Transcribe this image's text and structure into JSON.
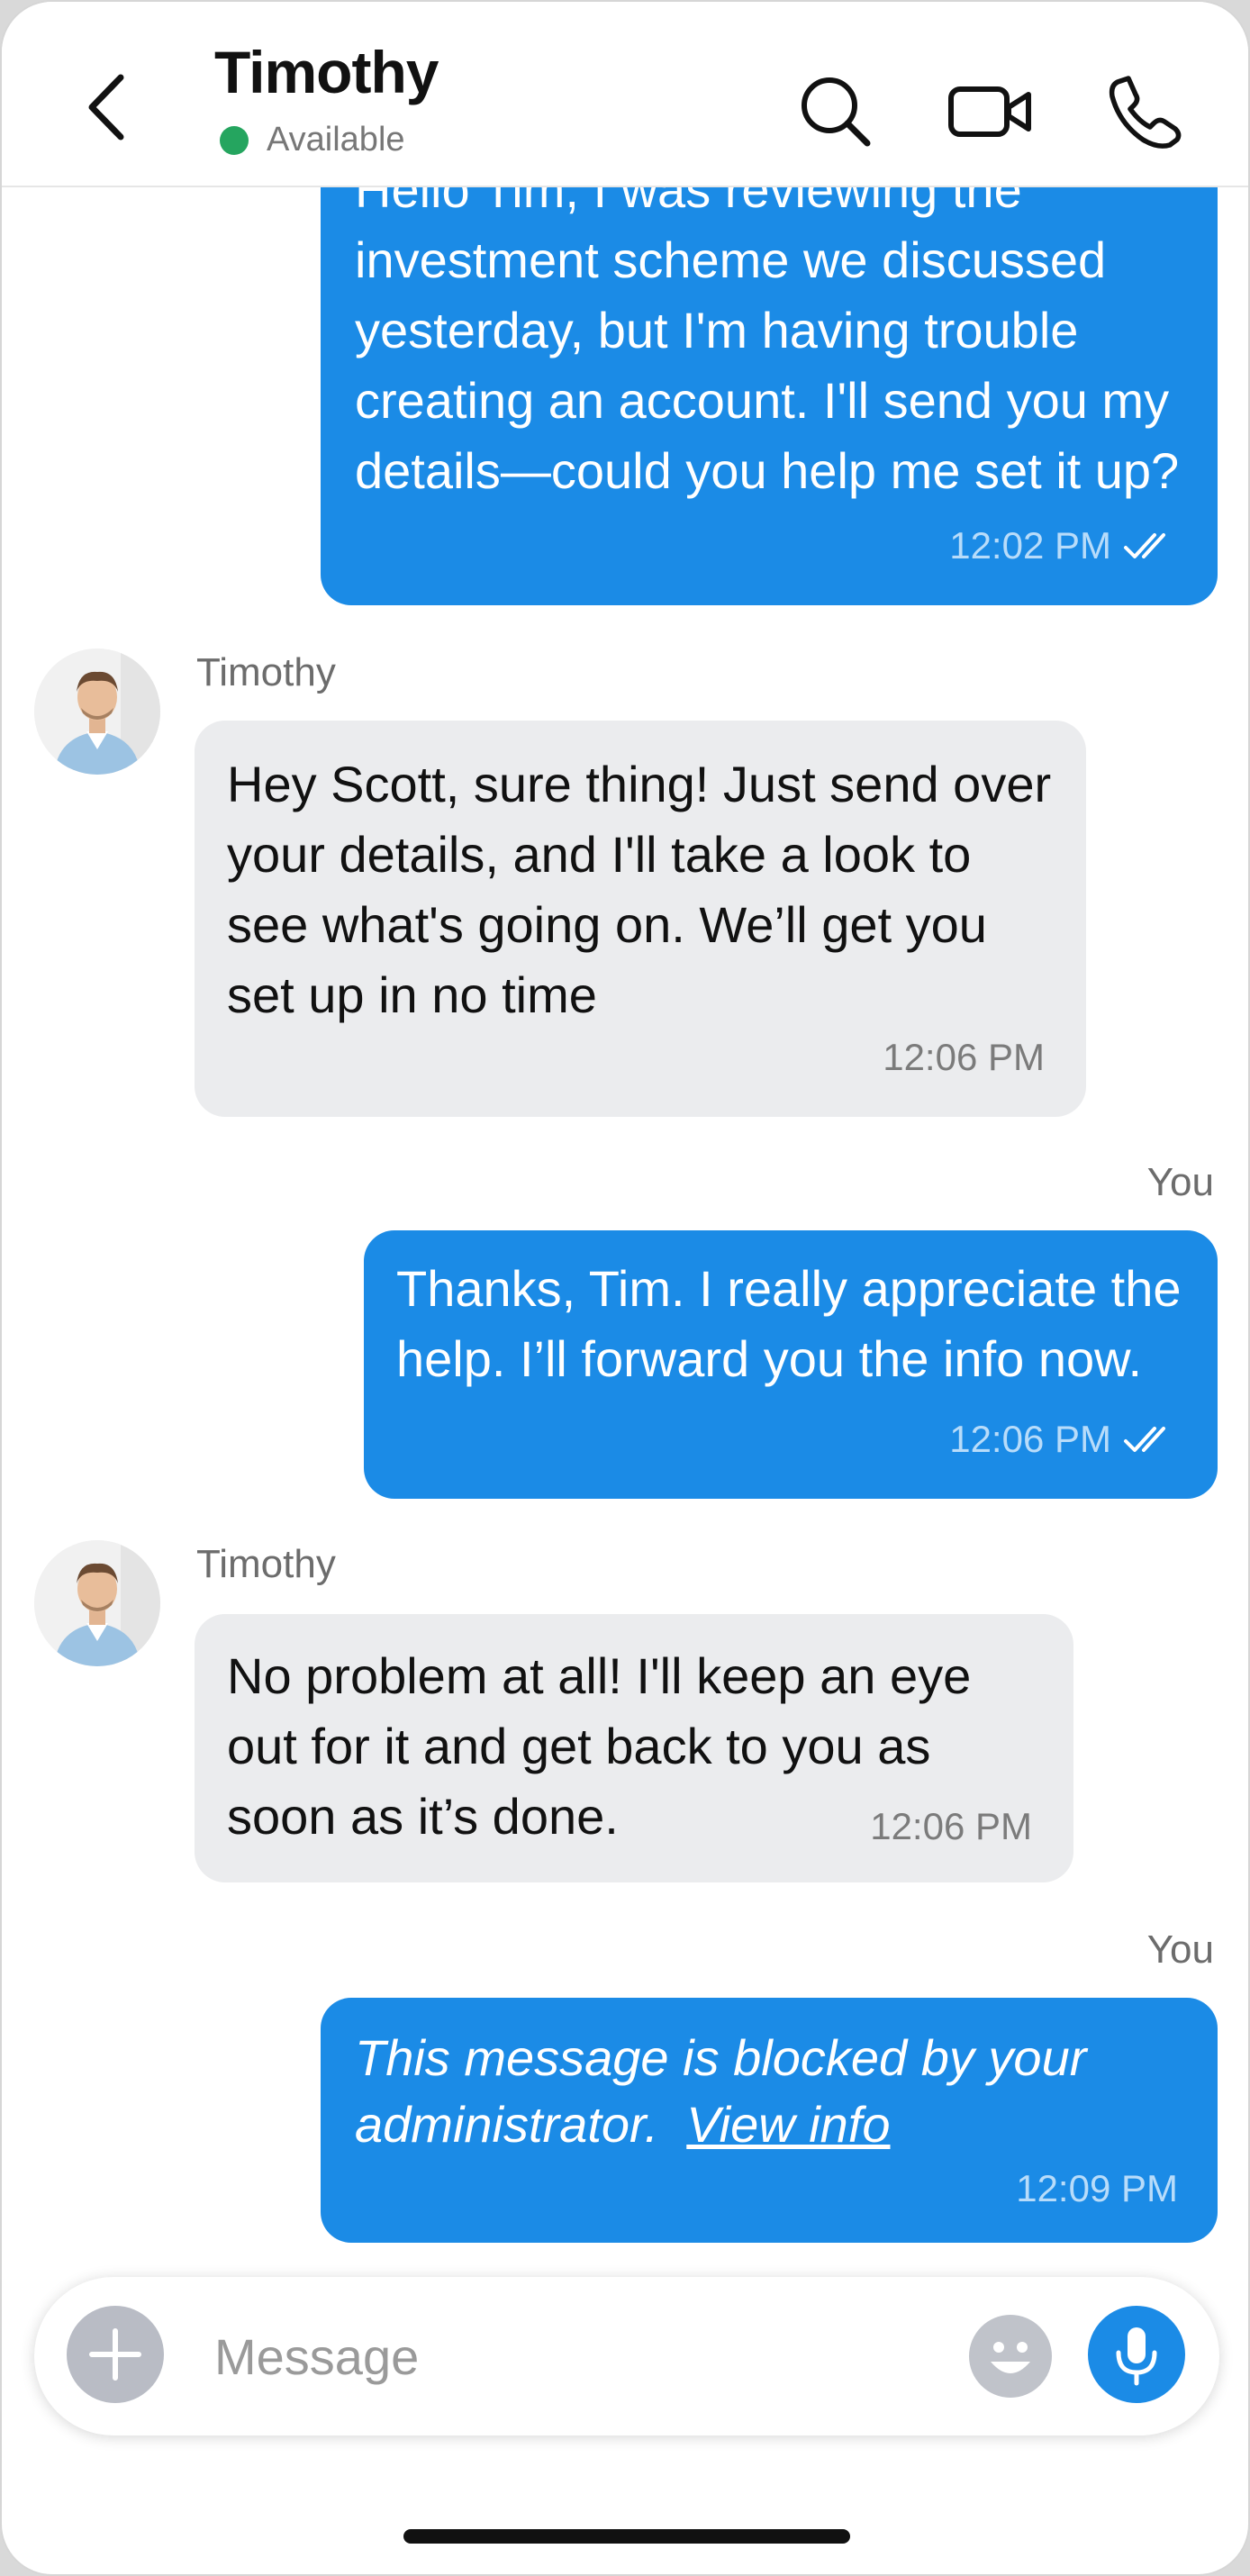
{
  "header": {
    "name": "Timothy",
    "status": "Available",
    "status_color": "#25a55f"
  },
  "messages": [
    {
      "direction": "out",
      "text": "Hello Tim, I was reviewing the investment scheme we discussed yesterday, but I'm having trouble creating an account. I'll send you my details—could you help me set it up?",
      "time": "12:02 PM",
      "read_icon": "double-check-icon"
    },
    {
      "direction": "in",
      "sender": "Timothy",
      "text": "Hey Scott, sure thing! Just send over your details, and I'll take a look to see what's going on. We’ll get you set up in no time",
      "time": "12:06 PM"
    },
    {
      "direction": "out",
      "sender": "You",
      "text": "Thanks, Tim. I really appreciate the help. I’ll forward you the info now.",
      "time": "12:06 PM",
      "read_icon": "double-check-icon"
    },
    {
      "direction": "in",
      "sender": "Timothy",
      "text": "No problem at all! I'll keep an eye out for it and get back to you as soon as it’s done.",
      "time": "12:06 PM"
    },
    {
      "direction": "out",
      "sender": "You",
      "text": "This message is blocked by your administrator.",
      "link": "View info",
      "time": "12:09 PM"
    }
  ],
  "composer": {
    "placeholder": "Message"
  },
  "colors": {
    "outgoing_bubble": "#1b8be6",
    "incoming_bubble": "#ebecee",
    "accent": "#1b8be6"
  }
}
